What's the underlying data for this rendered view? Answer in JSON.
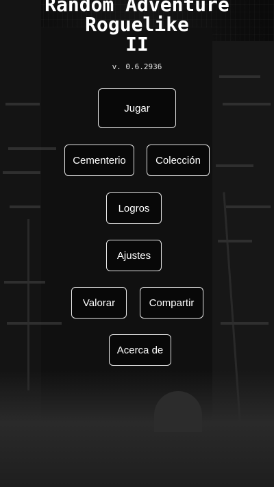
{
  "title": {
    "line1": "Random Adventure",
    "line2": "Roguelike",
    "line3": "II"
  },
  "version": "v. 0.6.2936",
  "menu": {
    "play": "Jugar",
    "cemetery": "Cementerio",
    "collection": "Colección",
    "achievements": "Logros",
    "settings": "Ajustes",
    "rate": "Valorar",
    "share": "Compartir",
    "about": "Acerca de"
  }
}
